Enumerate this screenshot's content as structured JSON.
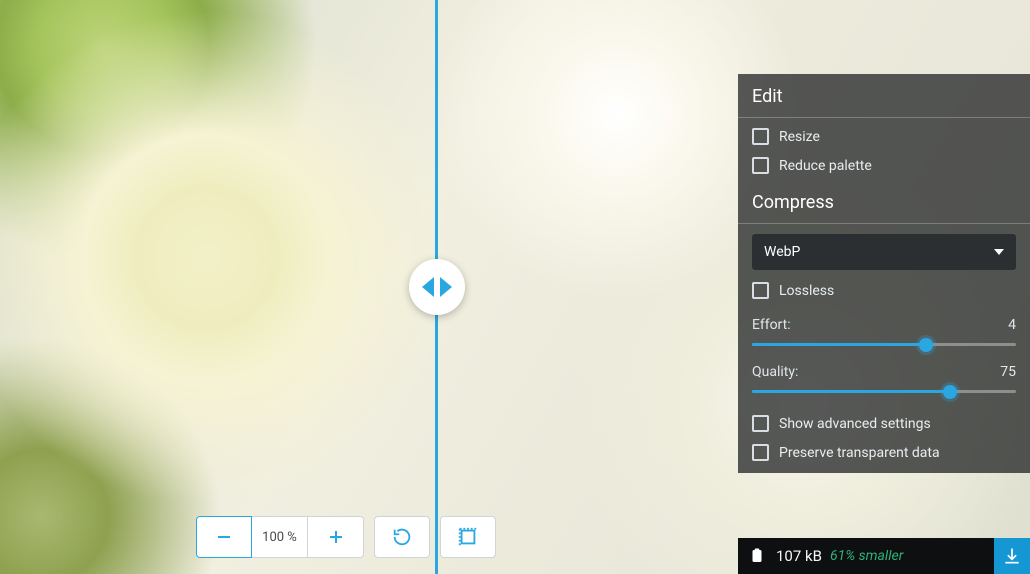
{
  "toolbar": {
    "zoom_level": "100 %"
  },
  "panel": {
    "edit_title": "Edit",
    "resize_label": "Resize",
    "reduce_palette_label": "Reduce palette",
    "compress_title": "Compress",
    "format_select": {
      "selected": "WebP"
    },
    "lossless_label": "Lossless",
    "effort": {
      "label": "Effort:",
      "value": "4"
    },
    "quality": {
      "label": "Quality:",
      "value": "75"
    },
    "show_advanced_label": "Show advanced settings",
    "preserve_transparent_label": "Preserve transparent data"
  },
  "result": {
    "size": "107 kB",
    "savings": "61% smaller"
  }
}
